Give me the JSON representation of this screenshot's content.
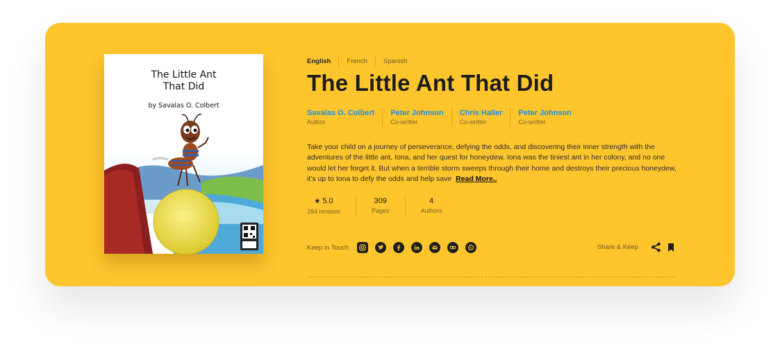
{
  "languages": [
    "English",
    "French",
    "Spanish"
  ],
  "cover": {
    "title": "The Little Ant\nThat Did",
    "author": "by Savalas O. Colbert",
    "qr_caption": "cornerQR"
  },
  "book": {
    "title": "The Little Ant That Did",
    "people": [
      {
        "name": "Savalas O. Colbert",
        "role": "Author"
      },
      {
        "name": "Peter Johnson",
        "role": "Co-writter"
      },
      {
        "name": "Chris Haller",
        "role": "Co-writter"
      },
      {
        "name": "Peter Johnson",
        "role": "Co-writter"
      }
    ],
    "description": "Take your child on a journey of perseverance, defying the odds, and discovering their inner strength with the adventures of the little ant, Iona, and her quest for honeydew. Iona was the tiniest ant in her colony, and no one would let her forget it. But when a terrible storm sweeps through their home and destroys their precious honeydew, it’s up to Iona to defy the odds and help save",
    "read_more": "Read More.."
  },
  "stats": [
    {
      "value": "5.0",
      "label": "284 reviews",
      "icon": "star-icon"
    },
    {
      "value": "309",
      "label": "Pages"
    },
    {
      "value": "4",
      "label": "Authors"
    }
  ],
  "social": {
    "label": "Keep in Touch",
    "icons": [
      "instagram-icon",
      "twitter-icon",
      "facebook-icon",
      "linkedin-icon",
      "email-icon",
      "link-icon",
      "whatsapp-icon"
    ]
  },
  "share": {
    "label": "Share & Keep",
    "icons": [
      "share-icon",
      "bookmark-icon"
    ]
  },
  "colors": {
    "card": "#fec52d",
    "accent_link": "#1a8fe0",
    "text_dark": "#1c1c1c"
  }
}
